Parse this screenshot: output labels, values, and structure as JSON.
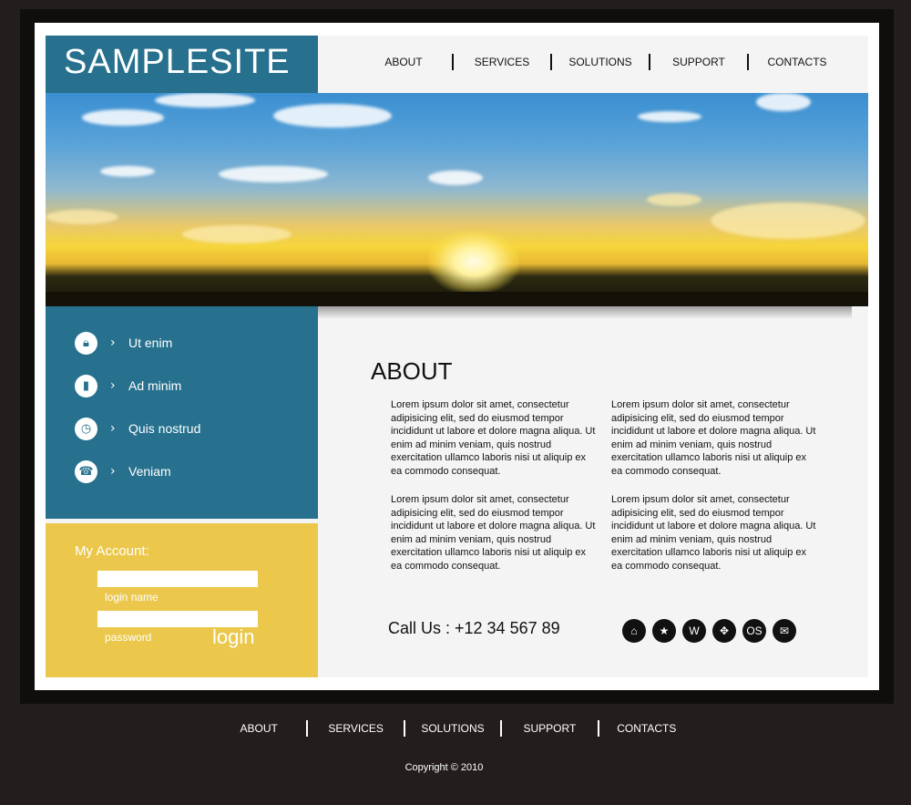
{
  "logo": {
    "text": "SAMPLESITE"
  },
  "nav": {
    "items": [
      "ABOUT",
      "SERVICES",
      "SOLUTIONS",
      "SUPPORT",
      "CONTACTS"
    ]
  },
  "sidebar": {
    "items": [
      {
        "icon": "lock-icon",
        "label": "Ut enim"
      },
      {
        "icon": "book-icon",
        "label": "Ad minim"
      },
      {
        "icon": "clock-icon",
        "label": "Quis nostrud"
      },
      {
        "icon": "phone-icon",
        "label": "Veniam"
      }
    ]
  },
  "account": {
    "title": "My Account:",
    "login_name_label": "login name",
    "password_label": "password",
    "login_button": "login"
  },
  "main": {
    "title": "ABOUT",
    "paragraphs": [
      "Lorem ipsum dolor sit amet, consectetur adipisicing elit, sed do eiusmod tempor incididunt ut labore et dolore magna aliqua. Ut enim ad minim veniam, quis nostrud exercitation ullamco laboris nisi ut aliquip ex ea commodo consequat.",
      "Lorem ipsum dolor sit amet, consectetur adipisicing elit, sed do eiusmod tempor incididunt ut labore et dolore magna aliqua. Ut enim ad minim veniam, quis nostrud exercitation ullamco laboris nisi ut aliquip ex ea commodo consequat.",
      "Lorem ipsum dolor sit amet, consectetur adipisicing elit, sed do eiusmod tempor incididunt ut labore et dolore magna aliqua. Ut enim ad minim veniam, quis nostrud exercitation ullamco laboris nisi ut aliquip ex ea commodo consequat.",
      "Lorem ipsum dolor sit amet, consectetur adipisicing elit, sed do eiusmod tempor incididunt ut labore et dolore magna aliqua. Ut enim ad minim veniam, quis nostrud exercitation ullamco laboris nisi ut aliquip ex ea commodo consequat."
    ],
    "call_us": "Call Us : +12 34 567 89",
    "social": [
      {
        "icon": "home-icon",
        "glyph": "⌂"
      },
      {
        "icon": "star-icon",
        "glyph": "★"
      },
      {
        "icon": "windows-icon",
        "glyph": "W"
      },
      {
        "icon": "network-icon",
        "glyph": "✥"
      },
      {
        "icon": "os-icon",
        "glyph": "OS"
      },
      {
        "icon": "mail-icon",
        "glyph": "✉"
      }
    ]
  },
  "footer": {
    "nav": [
      "ABOUT",
      "SERVICES",
      "SOLUTIONS",
      "SUPPORT",
      "CONTACTS"
    ],
    "copyright": "Copyright © 2010"
  },
  "colors": {
    "primary_blue": "#27718e",
    "accent_yellow": "#ebc84b",
    "background_dark": "#231e1d"
  }
}
